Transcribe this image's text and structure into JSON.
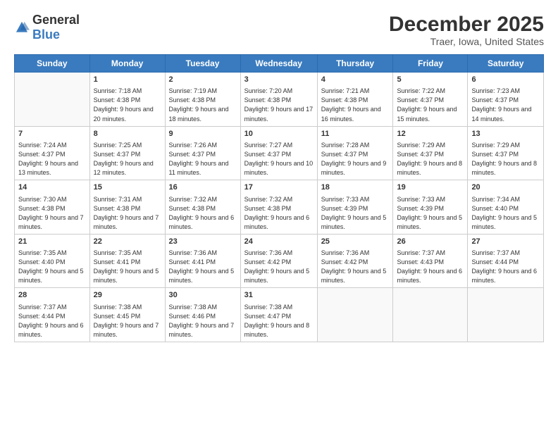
{
  "logo": {
    "general": "General",
    "blue": "Blue"
  },
  "title": "December 2025",
  "location": "Traer, Iowa, United States",
  "headers": [
    "Sunday",
    "Monday",
    "Tuesday",
    "Wednesday",
    "Thursday",
    "Friday",
    "Saturday"
  ],
  "weeks": [
    [
      {
        "day": "",
        "sunrise": "",
        "sunset": "",
        "daylight": ""
      },
      {
        "day": "1",
        "sunrise": "Sunrise: 7:18 AM",
        "sunset": "Sunset: 4:38 PM",
        "daylight": "Daylight: 9 hours and 20 minutes."
      },
      {
        "day": "2",
        "sunrise": "Sunrise: 7:19 AM",
        "sunset": "Sunset: 4:38 PM",
        "daylight": "Daylight: 9 hours and 18 minutes."
      },
      {
        "day": "3",
        "sunrise": "Sunrise: 7:20 AM",
        "sunset": "Sunset: 4:38 PM",
        "daylight": "Daylight: 9 hours and 17 minutes."
      },
      {
        "day": "4",
        "sunrise": "Sunrise: 7:21 AM",
        "sunset": "Sunset: 4:38 PM",
        "daylight": "Daylight: 9 hours and 16 minutes."
      },
      {
        "day": "5",
        "sunrise": "Sunrise: 7:22 AM",
        "sunset": "Sunset: 4:37 PM",
        "daylight": "Daylight: 9 hours and 15 minutes."
      },
      {
        "day": "6",
        "sunrise": "Sunrise: 7:23 AM",
        "sunset": "Sunset: 4:37 PM",
        "daylight": "Daylight: 9 hours and 14 minutes."
      }
    ],
    [
      {
        "day": "7",
        "sunrise": "Sunrise: 7:24 AM",
        "sunset": "Sunset: 4:37 PM",
        "daylight": "Daylight: 9 hours and 13 minutes."
      },
      {
        "day": "8",
        "sunrise": "Sunrise: 7:25 AM",
        "sunset": "Sunset: 4:37 PM",
        "daylight": "Daylight: 9 hours and 12 minutes."
      },
      {
        "day": "9",
        "sunrise": "Sunrise: 7:26 AM",
        "sunset": "Sunset: 4:37 PM",
        "daylight": "Daylight: 9 hours and 11 minutes."
      },
      {
        "day": "10",
        "sunrise": "Sunrise: 7:27 AM",
        "sunset": "Sunset: 4:37 PM",
        "daylight": "Daylight: 9 hours and 10 minutes."
      },
      {
        "day": "11",
        "sunrise": "Sunrise: 7:28 AM",
        "sunset": "Sunset: 4:37 PM",
        "daylight": "Daylight: 9 hours and 9 minutes."
      },
      {
        "day": "12",
        "sunrise": "Sunrise: 7:29 AM",
        "sunset": "Sunset: 4:37 PM",
        "daylight": "Daylight: 9 hours and 8 minutes."
      },
      {
        "day": "13",
        "sunrise": "Sunrise: 7:29 AM",
        "sunset": "Sunset: 4:37 PM",
        "daylight": "Daylight: 9 hours and 8 minutes."
      }
    ],
    [
      {
        "day": "14",
        "sunrise": "Sunrise: 7:30 AM",
        "sunset": "Sunset: 4:38 PM",
        "daylight": "Daylight: 9 hours and 7 minutes."
      },
      {
        "day": "15",
        "sunrise": "Sunrise: 7:31 AM",
        "sunset": "Sunset: 4:38 PM",
        "daylight": "Daylight: 9 hours and 7 minutes."
      },
      {
        "day": "16",
        "sunrise": "Sunrise: 7:32 AM",
        "sunset": "Sunset: 4:38 PM",
        "daylight": "Daylight: 9 hours and 6 minutes."
      },
      {
        "day": "17",
        "sunrise": "Sunrise: 7:32 AM",
        "sunset": "Sunset: 4:38 PM",
        "daylight": "Daylight: 9 hours and 6 minutes."
      },
      {
        "day": "18",
        "sunrise": "Sunrise: 7:33 AM",
        "sunset": "Sunset: 4:39 PM",
        "daylight": "Daylight: 9 hours and 5 minutes."
      },
      {
        "day": "19",
        "sunrise": "Sunrise: 7:33 AM",
        "sunset": "Sunset: 4:39 PM",
        "daylight": "Daylight: 9 hours and 5 minutes."
      },
      {
        "day": "20",
        "sunrise": "Sunrise: 7:34 AM",
        "sunset": "Sunset: 4:40 PM",
        "daylight": "Daylight: 9 hours and 5 minutes."
      }
    ],
    [
      {
        "day": "21",
        "sunrise": "Sunrise: 7:35 AM",
        "sunset": "Sunset: 4:40 PM",
        "daylight": "Daylight: 9 hours and 5 minutes."
      },
      {
        "day": "22",
        "sunrise": "Sunrise: 7:35 AM",
        "sunset": "Sunset: 4:41 PM",
        "daylight": "Daylight: 9 hours and 5 minutes."
      },
      {
        "day": "23",
        "sunrise": "Sunrise: 7:36 AM",
        "sunset": "Sunset: 4:41 PM",
        "daylight": "Daylight: 9 hours and 5 minutes."
      },
      {
        "day": "24",
        "sunrise": "Sunrise: 7:36 AM",
        "sunset": "Sunset: 4:42 PM",
        "daylight": "Daylight: 9 hours and 5 minutes."
      },
      {
        "day": "25",
        "sunrise": "Sunrise: 7:36 AM",
        "sunset": "Sunset: 4:42 PM",
        "daylight": "Daylight: 9 hours and 5 minutes."
      },
      {
        "day": "26",
        "sunrise": "Sunrise: 7:37 AM",
        "sunset": "Sunset: 4:43 PM",
        "daylight": "Daylight: 9 hours and 6 minutes."
      },
      {
        "day": "27",
        "sunrise": "Sunrise: 7:37 AM",
        "sunset": "Sunset: 4:44 PM",
        "daylight": "Daylight: 9 hours and 6 minutes."
      }
    ],
    [
      {
        "day": "28",
        "sunrise": "Sunrise: 7:37 AM",
        "sunset": "Sunset: 4:44 PM",
        "daylight": "Daylight: 9 hours and 6 minutes."
      },
      {
        "day": "29",
        "sunrise": "Sunrise: 7:38 AM",
        "sunset": "Sunset: 4:45 PM",
        "daylight": "Daylight: 9 hours and 7 minutes."
      },
      {
        "day": "30",
        "sunrise": "Sunrise: 7:38 AM",
        "sunset": "Sunset: 4:46 PM",
        "daylight": "Daylight: 9 hours and 7 minutes."
      },
      {
        "day": "31",
        "sunrise": "Sunrise: 7:38 AM",
        "sunset": "Sunset: 4:47 PM",
        "daylight": "Daylight: 9 hours and 8 minutes."
      },
      {
        "day": "",
        "sunrise": "",
        "sunset": "",
        "daylight": ""
      },
      {
        "day": "",
        "sunrise": "",
        "sunset": "",
        "daylight": ""
      },
      {
        "day": "",
        "sunrise": "",
        "sunset": "",
        "daylight": ""
      }
    ]
  ]
}
